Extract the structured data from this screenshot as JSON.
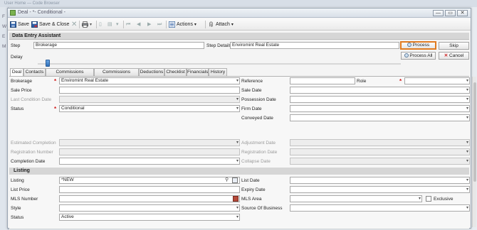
{
  "background": {
    "title": "User Home — Code Browser",
    "side_letters": [
      "F",
      "W",
      "E",
      "M"
    ]
  },
  "window": {
    "title": "Deal - *- Conditional -",
    "buttons": {
      "minimize": "—",
      "restore": "▭",
      "close": "✕"
    }
  },
  "toolbar": {
    "save": "Save",
    "save_close": "Save & Close",
    "actions": "Actions",
    "attach": "Attach"
  },
  "assistant": {
    "title": "Data Entry Assistant",
    "step_label": "Step",
    "step_value": "Brokerage",
    "step_details_label": "Step Details",
    "step_details_value": "Enviromint Real Estate",
    "delay_label": "Delay",
    "delay_level": 0.02,
    "process": "Process",
    "skip": "Skip",
    "process_all": "Process All",
    "cancel": "Cancel"
  },
  "tabs": [
    "Deal",
    "Contacts",
    "Commissions Receivable",
    "Commissions Payable",
    "Deductions",
    "Checklist",
    "Financials",
    "History"
  ],
  "deal": {
    "brokerage_label": "Brokerage",
    "brokerage_value": "Enviromint Real Estate",
    "sale_price_label": "Sale Price",
    "sale_price_value": "",
    "last_condition_date_label": "Last Condition Date",
    "status_label": "Status",
    "status_value": "Conditional",
    "reference_label": "Reference",
    "role_label": "Role",
    "sale_date_label": "Sale Date",
    "possession_date_label": "Possession Date",
    "firm_date_label": "Firm Date",
    "conveyed_date_label": "Conveyed Date",
    "estimated_completion_label": "Estimated Completion",
    "registration_number_label": "Registration Number",
    "completion_date_label": "Completion Date",
    "adjustment_date_label": "Adjustment Date",
    "registration_date_label": "Registration Date",
    "collapse_date_label": "Collapse Date"
  },
  "listing": {
    "title": "Listing",
    "listing_label": "Listing",
    "listing_value": "*NEW",
    "list_price_label": "List Price",
    "mls_number_label": "MLS Number",
    "style_label": "Style",
    "status_label": "Status",
    "status_value": "Active",
    "list_date_label": "List Date",
    "expiry_date_label": "Expiry Date",
    "mls_area_label": "MLS Area",
    "exclusive_label": "Exclusive",
    "source_of_business_label": "Source Of Business"
  },
  "colors": {
    "highlight": "#e07b21",
    "required": "#d01818",
    "section_bg": "#d6d6d6"
  }
}
